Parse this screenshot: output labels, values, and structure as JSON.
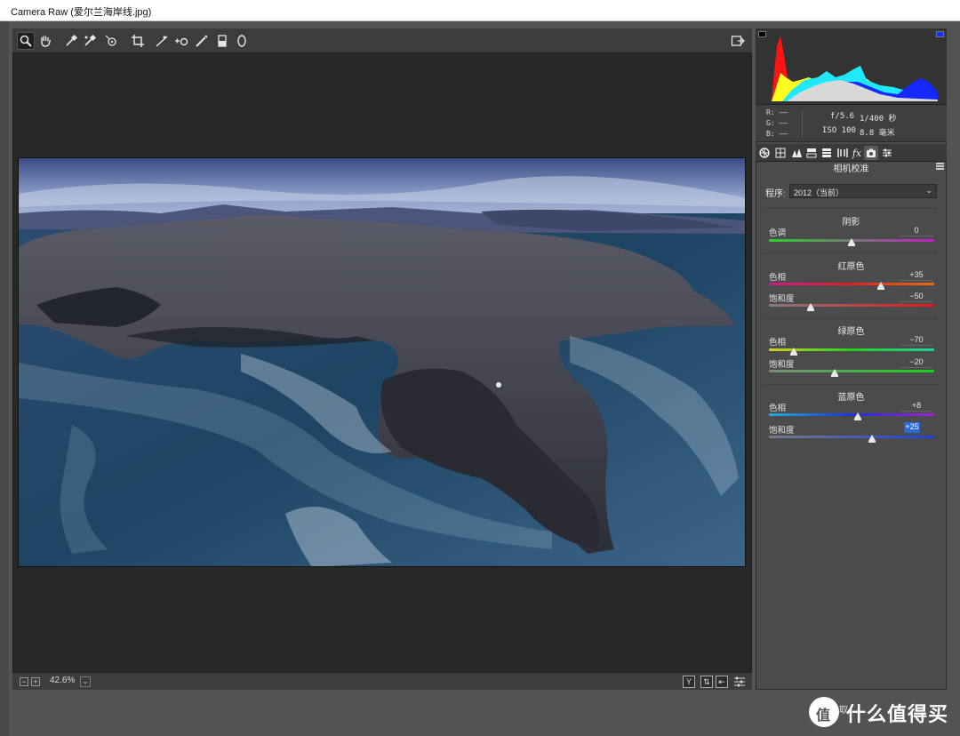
{
  "window": {
    "title": "Camera Raw (爱尔兰海岸线.jpg)"
  },
  "toolbar": {
    "tools": [
      "zoom-icon",
      "hand-icon",
      "white-balance-icon",
      "color-sampler-icon",
      "targeted-adjustment-icon",
      "crop-icon",
      "straighten-icon",
      "spot-removal-icon",
      "red-eye-icon",
      "adjustment-brush-icon",
      "graduated-filter-icon",
      "radial-filter-icon"
    ],
    "export_icon": "open-preferences-icon"
  },
  "status": {
    "zoom_minus": "−",
    "zoom_plus": "+",
    "zoom_value": "42.6%",
    "zoom_caret": "⌄",
    "view_y": "Y",
    "view_swap": "⇅",
    "view_copy": "⇤"
  },
  "info": {
    "r_label": "R:",
    "g_label": "G:",
    "b_label": "B:",
    "r_value": "——",
    "g_value": "——",
    "b_value": "——",
    "aperture": "f/5.6",
    "shutter": "1/400 秒",
    "iso": "ISO 100",
    "focal": "8.8 毫米"
  },
  "tabs": [
    "basic-icon",
    "tone-curve-icon",
    "detail-icon",
    "hsl-icon",
    "split-toning-icon",
    "lens-corrections-icon",
    "effects-icon",
    "camera-calibration-icon",
    "presets-icon"
  ],
  "panel": {
    "title": "相机校准",
    "process_label": "程序:",
    "process_value": "2012（当前）",
    "process_caret": "⌄",
    "groups": [
      {
        "title": "阴影",
        "sliders": [
          {
            "label": "色调",
            "value": "0",
            "position": 0.5
          }
        ]
      },
      {
        "title": "红原色",
        "sliders": [
          {
            "label": "色相",
            "value": "+35",
            "position": 0.675
          },
          {
            "label": "饱和度",
            "value": "−50",
            "position": 0.25
          }
        ]
      },
      {
        "title": "绿原色",
        "sliders": [
          {
            "label": "色相",
            "value": "−70",
            "position": 0.15
          },
          {
            "label": "饱和度",
            "value": "−20",
            "position": 0.4
          }
        ]
      },
      {
        "title": "蓝原色",
        "sliders": [
          {
            "label": "色相",
            "value": "+8",
            "position": 0.54
          },
          {
            "label": "饱和度",
            "value": "+25",
            "position": 0.625
          }
        ]
      }
    ]
  },
  "brand": {
    "logo_char": "值",
    "text": "什么值得买"
  },
  "bottom": {
    "hidden_label": "取"
  },
  "colors": {
    "accent": "#2a6ad8",
    "histogram_red": "#ff1010",
    "histogram_blue": "#1020ff"
  }
}
